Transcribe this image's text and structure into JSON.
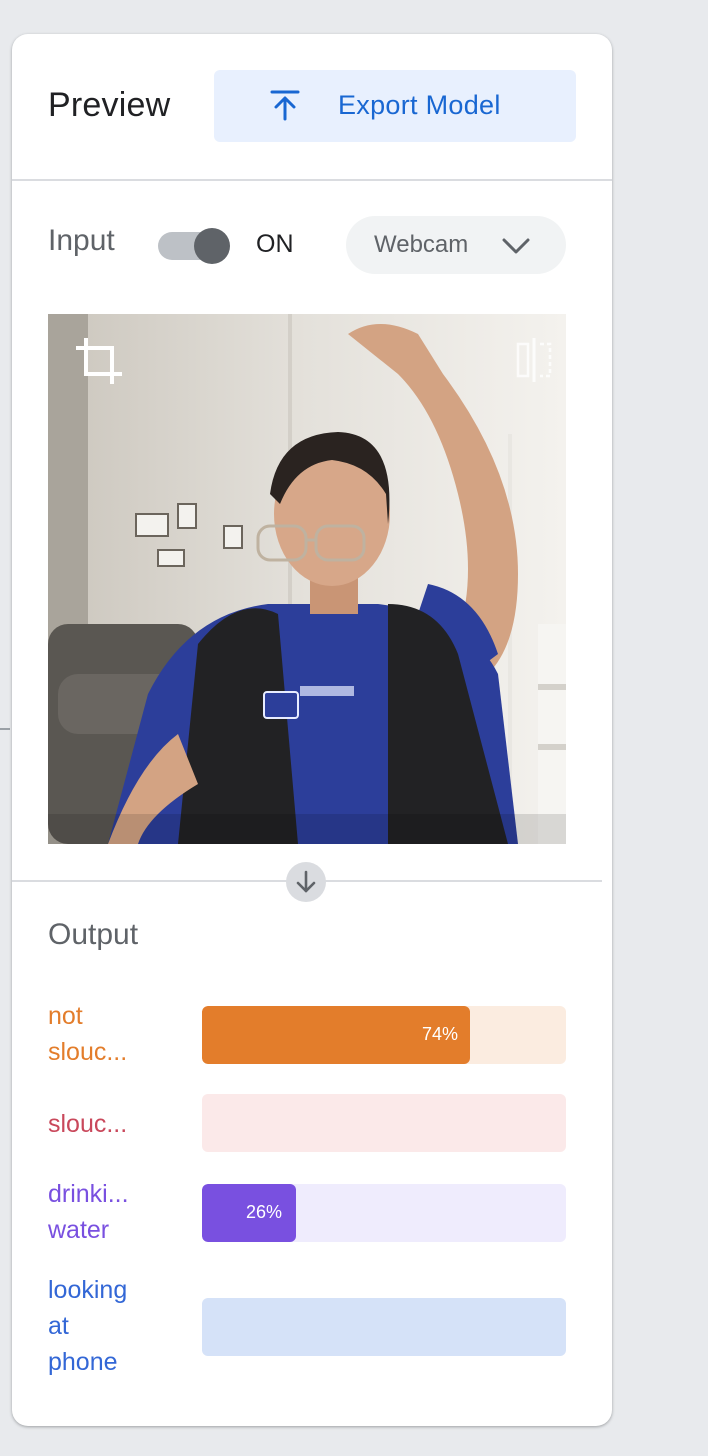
{
  "header": {
    "title": "Preview",
    "export_label": "Export Model",
    "export_icon": "upload-icon"
  },
  "input": {
    "label": "Input",
    "toggle_state": "ON",
    "source": "Webcam",
    "crop_icon": "crop-icon",
    "flip_icon": "flip-icon"
  },
  "output": {
    "title": "Output",
    "classes": [
      {
        "label": "not slouc...",
        "line1": "not",
        "line2": "slouc...",
        "percent": 74,
        "percent_label": "74%",
        "color": "#e37d2b",
        "track": "#fbece0"
      },
      {
        "label": "slouc...",
        "percent": 0,
        "percent_label": "",
        "color": "#c9485b",
        "track": "#fbe9e9"
      },
      {
        "label": "drinki... water",
        "line1": "drinki...",
        "line2": "water",
        "percent": 26,
        "percent_label": "26%",
        "color": "#7950e0",
        "track": "#efecfd"
      },
      {
        "label": "looking at phone",
        "line1": "looking",
        "line2": "at",
        "line3": "phone",
        "percent": 0,
        "percent_label": "",
        "color": "#3367d6",
        "track": "#d5e2f8"
      }
    ]
  },
  "colors": {
    "accent": "#1967d2",
    "export_bg": "#e8f0fe"
  }
}
